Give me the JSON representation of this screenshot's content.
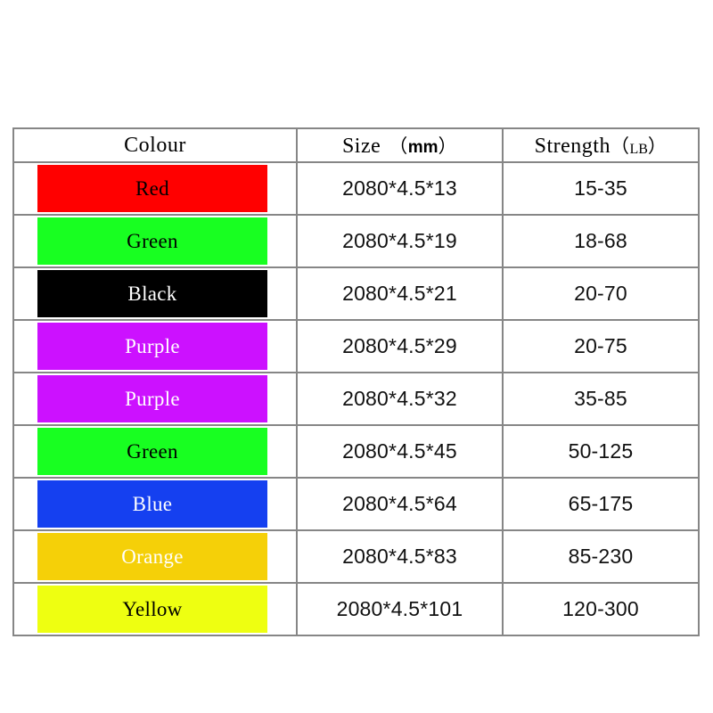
{
  "table": {
    "headers": {
      "colour": "Colour",
      "size_name": "Size",
      "size_unit_open": "（",
      "size_unit": "mm",
      "size_unit_close": "）",
      "strength_name": "Strength",
      "strength_unit_open": "（",
      "strength_unit": "LB",
      "strength_unit_close": "）"
    },
    "rows": [
      {
        "colour": "Red",
        "swatch_hex": "#FF0000",
        "label_hex": "#000000",
        "size": "2080*4.5*13",
        "strength": "15-35"
      },
      {
        "colour": "Green",
        "swatch_hex": "#18FF21",
        "label_hex": "#000000",
        "size": "2080*4.5*19",
        "strength": "18-68"
      },
      {
        "colour": "Black",
        "swatch_hex": "#000000",
        "label_hex": "#FFFFFF",
        "size": "2080*4.5*21",
        "strength": "20-70"
      },
      {
        "colour": "Purple",
        "swatch_hex": "#CC11FF",
        "label_hex": "#FFFFFF",
        "size": "2080*4.5*29",
        "strength": "20-75"
      },
      {
        "colour": "Purple",
        "swatch_hex": "#CC11FF",
        "label_hex": "#FFFFFF",
        "size": "2080*4.5*32",
        "strength": "35-85"
      },
      {
        "colour": "Green",
        "swatch_hex": "#18FF21",
        "label_hex": "#000000",
        "size": "2080*4.5*45",
        "strength": "50-125"
      },
      {
        "colour": "Blue",
        "swatch_hex": "#1540F0",
        "label_hex": "#FFFFFF",
        "size": "2080*4.5*64",
        "strength": "65-175"
      },
      {
        "colour": "Orange",
        "swatch_hex": "#F5D008",
        "label_hex": "#FFFFFF",
        "size": "2080*4.5*83",
        "strength": "85-230"
      },
      {
        "colour": "Yellow",
        "swatch_hex": "#EEFF11",
        "label_hex": "#000000",
        "size": "2080*4.5*101",
        "strength": "120-300"
      }
    ]
  }
}
